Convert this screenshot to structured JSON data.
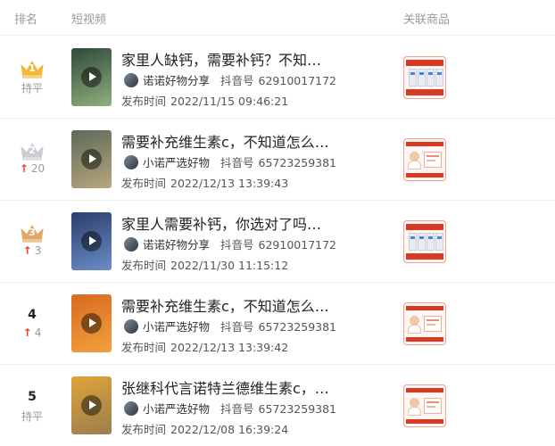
{
  "header": {
    "rank_label": "排名",
    "video_label": "短视频",
    "product_label": "关联商品"
  },
  "rows": [
    {
      "rank": "1",
      "crown": "gold-crown-icon",
      "change_text": "持平",
      "change_direction": "none",
      "title": "家里人缺钙，需要补钙？不知…",
      "author": "诺诺好物分享",
      "douyin_label": "抖音号",
      "douyin_id": "62910017172",
      "time_label": "发布时间",
      "time": "2022/11/15 09:46:21",
      "thumb_colors": [
        "#2f4a3a",
        "#8fb07d"
      ],
      "product": "calcium-product"
    },
    {
      "rank": "2",
      "crown": "silver-crown-icon",
      "change_text": "20",
      "change_direction": "up",
      "title": "需要补充维生素c，不知道怎么…",
      "author": "小诺严选好物",
      "douyin_label": "抖音号",
      "douyin_id": "65723259381",
      "time_label": "发布时间",
      "time": "2022/12/13 13:39:43",
      "thumb_colors": [
        "#5b6b58",
        "#b8a67e"
      ],
      "product": "vitamin-c-product"
    },
    {
      "rank": "3",
      "crown": "bronze-crown-icon",
      "change_text": "3",
      "change_direction": "up",
      "title": "家里人需要补钙，你选对了吗…",
      "author": "诺诺好物分享",
      "douyin_label": "抖音号",
      "douyin_id": "62910017172",
      "time_label": "发布时间",
      "time": "2022/11/30 11:15:12",
      "thumb_colors": [
        "#2b3f6b",
        "#6a8cc8"
      ],
      "product": "calcium-product"
    },
    {
      "rank": "4",
      "crown": "",
      "change_text": "4",
      "change_direction": "up",
      "title": "需要补充维生素c，不知道怎么…",
      "author": "小诺严选好物",
      "douyin_label": "抖音号",
      "douyin_id": "65723259381",
      "time_label": "发布时间",
      "time": "2022/12/13 13:39:42",
      "thumb_colors": [
        "#d86a1f",
        "#f3a03c"
      ],
      "product": "vitamin-c-product"
    },
    {
      "rank": "5",
      "crown": "",
      "change_text": "持平",
      "change_direction": "none",
      "title": "张继科代言诺特兰德维生素c，…",
      "author": "小诺严选好物",
      "douyin_label": "抖音号",
      "douyin_id": "65723259381",
      "time_label": "发布时间",
      "time": "2022/12/08 16:39:24",
      "thumb_colors": [
        "#e0a43a",
        "#9b7e4e"
      ],
      "product": "vitamin-c-product"
    }
  ],
  "colors": {
    "up_arrow": "#f03a2e",
    "gold": "#f2b73a",
    "silver": "#c9ccd3",
    "bronze": "#e2a866"
  }
}
